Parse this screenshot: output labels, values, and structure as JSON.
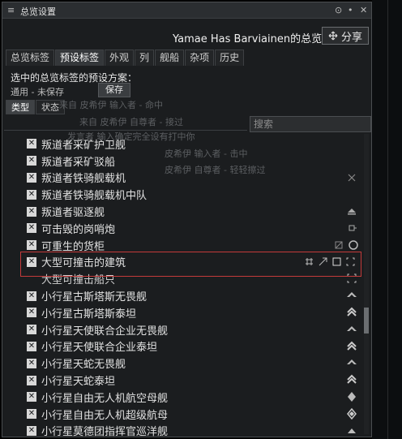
{
  "window": {
    "title": "总览设置",
    "menu_icon": "hamburger-icon",
    "buttons": [
      "⊙",
      "•",
      "✕"
    ]
  },
  "header": {
    "owner_title": "Yamae Has Barviainen的总览",
    "share_label": "分享",
    "share_icon": "share-icon"
  },
  "tabs": [
    "总览标签",
    "预设标签",
    "外观",
    "列",
    "舰船",
    "杂项",
    "历史"
  ],
  "active_tab": "预设标签",
  "preset": {
    "label": "选中的总览标签的预设方案：",
    "value": "通用 - 未保存",
    "save_label": "保存"
  },
  "subtabs": [
    "类型",
    "状态"
  ],
  "active_subtab": "类型",
  "search": {
    "placeholder": "搜索"
  },
  "ghost_lines": [
    "来自  皮希伊  输入者 - 命中",
    "来自  皮希伊  自尊者 - 接过",
    "发言者  输入确定完全设有打中你",
    "皮希伊  输入者 - 击中",
    "皮希伊  自尊者 - 轻轻擦过"
  ],
  "items": [
    {
      "label": "叛道者采矿护卫舰",
      "checked": true,
      "icon": ""
    },
    {
      "label": "叛道者采矿驳船",
      "checked": true,
      "icon": ""
    },
    {
      "label": "叛道者铁骑舰载机",
      "checked": true,
      "icon": "fighter-icon"
    },
    {
      "label": "叛道者铁骑舰载机中队",
      "checked": true,
      "icon": ""
    },
    {
      "label": "叛道者驱逐舰",
      "checked": true,
      "icon": "destroyer-icon"
    },
    {
      "label": "可击毁的岗哨炮",
      "checked": true,
      "icon": "sentry-icon"
    },
    {
      "label": "可重生的货柜",
      "checked": true,
      "icon": "container-icon"
    },
    {
      "label": "大型可撞击的建筑",
      "checked": true,
      "icon": "structure-icon"
    },
    {
      "label": "大型可撞击船只",
      "checked": false,
      "icon": "ship-icon"
    },
    {
      "label": "小行星古斯塔斯无畏舰",
      "checked": true,
      "icon": "dreadnought-icon"
    },
    {
      "label": "小行星古斯塔斯泰坦",
      "checked": true,
      "icon": "titan-icon"
    },
    {
      "label": "小行星天使联合企业无畏舰",
      "checked": true,
      "icon": "dreadnought-icon"
    },
    {
      "label": "小行星天使联合企业泰坦",
      "checked": true,
      "icon": "titan-icon"
    },
    {
      "label": "小行星天蛇无畏舰",
      "checked": true,
      "icon": "dreadnought-icon"
    },
    {
      "label": "小行星天蛇泰坦",
      "checked": true,
      "icon": "titan-icon"
    },
    {
      "label": "小行星自由无人机航空母舰",
      "checked": true,
      "icon": "carrier-icon"
    },
    {
      "label": "小行星自由无人机超级航母",
      "checked": true,
      "icon": "supercarrier-icon"
    },
    {
      "label": "小行星莫德团指挥官巡洋舰",
      "checked": true,
      "icon": "cruiser-icon"
    }
  ],
  "colors": {
    "highlight_border": "#c43a3a",
    "background": "#1b1d1f"
  }
}
